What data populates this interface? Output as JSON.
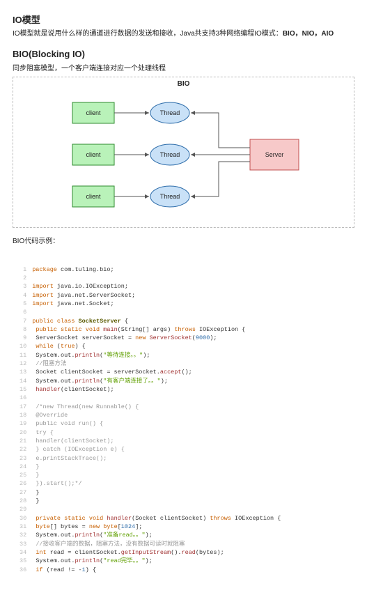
{
  "heading1": "IO模型",
  "heading1_desc_pre": "IO模型就是说用什么样的通道进行数据的发送和接收，Java共支持3种网络编程IO模式：",
  "heading1_desc_bold": "BIO，NIO，AIO",
  "heading2": "BIO(Blocking IO)",
  "heading2_desc": "同步阻塞模型，一个客户端连接对应一个处理线程",
  "diagram": {
    "title": "BIO",
    "client": "client",
    "thread": "Thread",
    "server": "Server"
  },
  "code_heading": "BIO代码示例：",
  "code_lines": [
    [
      [
        "kw",
        "package"
      ],
      [
        "op",
        " com"
      ],
      [
        "op",
        "."
      ],
      [
        "op",
        "tuling"
      ],
      [
        "op",
        "."
      ],
      [
        "op",
        "bio"
      ],
      [
        "op",
        ";"
      ]
    ],
    [
      [
        "op",
        ""
      ]
    ],
    [
      [
        "kw",
        "import"
      ],
      [
        "op",
        " java"
      ],
      [
        "op",
        "."
      ],
      [
        "op",
        "io"
      ],
      [
        "op",
        "."
      ],
      [
        "op",
        "IOException"
      ],
      [
        "op",
        ";"
      ]
    ],
    [
      [
        "kw",
        "import"
      ],
      [
        "op",
        " java"
      ],
      [
        "op",
        "."
      ],
      [
        "op",
        "net"
      ],
      [
        "op",
        "."
      ],
      [
        "op",
        "ServerSocket"
      ],
      [
        "op",
        ";"
      ]
    ],
    [
      [
        "kw",
        "import"
      ],
      [
        "op",
        " java"
      ],
      [
        "op",
        "."
      ],
      [
        "op",
        "net"
      ],
      [
        "op",
        "."
      ],
      [
        "op",
        "Socket"
      ],
      [
        "op",
        ";"
      ]
    ],
    [
      [
        "op",
        ""
      ]
    ],
    [
      [
        "kw",
        "public"
      ],
      [
        "op",
        " "
      ],
      [
        "kw",
        "class"
      ],
      [
        "op",
        " "
      ],
      [
        "name",
        "SocketServer"
      ],
      [
        "op",
        " {"
      ]
    ],
    [
      [
        "op",
        " "
      ],
      [
        "kw",
        "public"
      ],
      [
        "op",
        " "
      ],
      [
        "kw",
        "static"
      ],
      [
        "op",
        " "
      ],
      [
        "kw",
        "void"
      ],
      [
        "op",
        " "
      ],
      [
        "call",
        "main"
      ],
      [
        "op",
        "("
      ],
      [
        "op",
        "String"
      ],
      [
        "op",
        "[] args"
      ],
      [
        "op",
        ") "
      ],
      [
        "kw",
        "throws"
      ],
      [
        "op",
        " "
      ],
      [
        "op",
        "IOException"
      ],
      [
        "op",
        " {"
      ]
    ],
    [
      [
        "op",
        " "
      ],
      [
        "op",
        "ServerSocket serverSocket "
      ],
      [
        "op",
        "="
      ],
      [
        "op",
        " "
      ],
      [
        "kw",
        "new"
      ],
      [
        "op",
        " "
      ],
      [
        "call",
        "ServerSocket"
      ],
      [
        "op",
        "("
      ],
      [
        "num",
        "9000"
      ],
      [
        "op",
        ");"
      ]
    ],
    [
      [
        "op",
        " "
      ],
      [
        "kw",
        "while"
      ],
      [
        "op",
        " ("
      ],
      [
        "bool",
        "true"
      ],
      [
        "op",
        ") {"
      ]
    ],
    [
      [
        "op",
        " "
      ],
      [
        "op",
        "System"
      ],
      [
        "op",
        "."
      ],
      [
        "op",
        "out"
      ],
      [
        "op",
        "."
      ],
      [
        "call",
        "println"
      ],
      [
        "op",
        "("
      ],
      [
        "str",
        "\"等待连接。。\""
      ],
      [
        "op",
        ");"
      ]
    ],
    [
      [
        "op",
        " "
      ],
      [
        "cmt",
        "//阻塞方法"
      ]
    ],
    [
      [
        "op",
        " "
      ],
      [
        "op",
        "Socket clientSocket "
      ],
      [
        "op",
        "="
      ],
      [
        "op",
        " serverSocket"
      ],
      [
        "op",
        "."
      ],
      [
        "call",
        "accept"
      ],
      [
        "op",
        "();"
      ]
    ],
    [
      [
        "op",
        " "
      ],
      [
        "op",
        "System"
      ],
      [
        "op",
        "."
      ],
      [
        "op",
        "out"
      ],
      [
        "op",
        "."
      ],
      [
        "call",
        "println"
      ],
      [
        "op",
        "("
      ],
      [
        "str",
        "\"有客户端连接了。。\""
      ],
      [
        "op",
        ");"
      ]
    ],
    [
      [
        "op",
        " "
      ],
      [
        "call",
        "handler"
      ],
      [
        "op",
        "(clientSocket);"
      ]
    ],
    [
      [
        "op",
        ""
      ]
    ],
    [
      [
        "op",
        " "
      ],
      [
        "cmt",
        "/*new Thread(new Runnable() {"
      ]
    ],
    [
      [
        "op",
        " "
      ],
      [
        "cmt",
        "@Override"
      ]
    ],
    [
      [
        "op",
        " "
      ],
      [
        "cmt",
        "public void run() {"
      ]
    ],
    [
      [
        "op",
        " "
      ],
      [
        "cmt",
        "try {"
      ]
    ],
    [
      [
        "op",
        " "
      ],
      [
        "cmt",
        "handler(clientSocket);"
      ]
    ],
    [
      [
        "op",
        " "
      ],
      [
        "cmt",
        "} catch (IOException e) {"
      ]
    ],
    [
      [
        "op",
        " "
      ],
      [
        "cmt",
        "e.printStackTrace();"
      ]
    ],
    [
      [
        "op",
        " "
      ],
      [
        "cmt",
        "}"
      ]
    ],
    [
      [
        "op",
        " "
      ],
      [
        "cmt",
        "}"
      ]
    ],
    [
      [
        "op",
        " "
      ],
      [
        "cmt",
        "}).start();*/"
      ]
    ],
    [
      [
        "op",
        " "
      ],
      [
        "op",
        "}"
      ]
    ],
    [
      [
        "op",
        " "
      ],
      [
        "op",
        "}"
      ]
    ],
    [
      [
        "op",
        ""
      ]
    ],
    [
      [
        "op",
        " "
      ],
      [
        "kw",
        "private"
      ],
      [
        "op",
        " "
      ],
      [
        "kw",
        "static"
      ],
      [
        "op",
        " "
      ],
      [
        "kw",
        "void"
      ],
      [
        "op",
        " "
      ],
      [
        "call",
        "handler"
      ],
      [
        "op",
        "("
      ],
      [
        "op",
        "Socket clientSocket"
      ],
      [
        "op",
        ") "
      ],
      [
        "kw",
        "throws"
      ],
      [
        "op",
        " "
      ],
      [
        "op",
        "IOException"
      ],
      [
        "op",
        " {"
      ]
    ],
    [
      [
        "op",
        " "
      ],
      [
        "kw",
        "byte"
      ],
      [
        "op",
        "[] bytes "
      ],
      [
        "op",
        "="
      ],
      [
        "op",
        " "
      ],
      [
        "kw",
        "new"
      ],
      [
        "op",
        " "
      ],
      [
        "kw",
        "byte"
      ],
      [
        "op",
        "["
      ],
      [
        "num",
        "1024"
      ],
      [
        "op",
        "];"
      ]
    ],
    [
      [
        "op",
        " "
      ],
      [
        "op",
        "System"
      ],
      [
        "op",
        "."
      ],
      [
        "op",
        "out"
      ],
      [
        "op",
        "."
      ],
      [
        "call",
        "println"
      ],
      [
        "op",
        "("
      ],
      [
        "str",
        "\"准备read。。\""
      ],
      [
        "op",
        ");"
      ]
    ],
    [
      [
        "op",
        " "
      ],
      [
        "cmt",
        "//接收客户端的数据，阻塞方法，没有数据可读时就阻塞"
      ]
    ],
    [
      [
        "op",
        " "
      ],
      [
        "kw",
        "int"
      ],
      [
        "op",
        " read "
      ],
      [
        "op",
        "="
      ],
      [
        "op",
        " clientSocket"
      ],
      [
        "op",
        "."
      ],
      [
        "call",
        "getInputStream"
      ],
      [
        "op",
        "()"
      ],
      [
        "op",
        "."
      ],
      [
        "call",
        "read"
      ],
      [
        "op",
        "(bytes);"
      ]
    ],
    [
      [
        "op",
        " "
      ],
      [
        "op",
        "System"
      ],
      [
        "op",
        "."
      ],
      [
        "op",
        "out"
      ],
      [
        "op",
        "."
      ],
      [
        "call",
        "println"
      ],
      [
        "op",
        "("
      ],
      [
        "str",
        "\"read完毕。。\""
      ],
      [
        "op",
        ");"
      ]
    ],
    [
      [
        "op",
        " "
      ],
      [
        "kw",
        "if"
      ],
      [
        "op",
        " (read "
      ],
      [
        "op",
        "!="
      ],
      [
        "op",
        " "
      ],
      [
        "op",
        "-"
      ],
      [
        "num",
        "1"
      ],
      [
        "op",
        ") {"
      ]
    ]
  ]
}
